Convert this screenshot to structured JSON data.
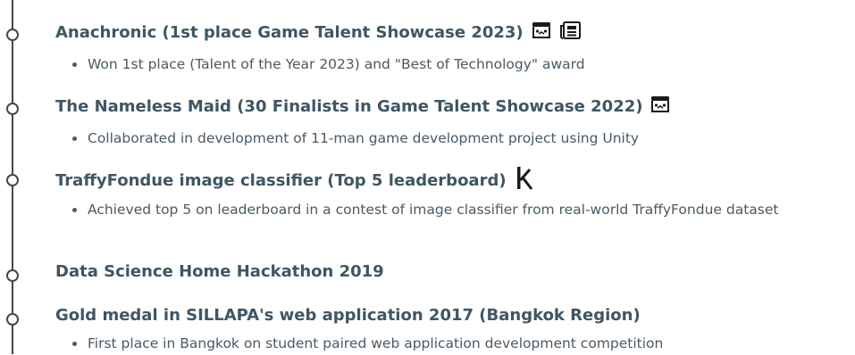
{
  "entries": [
    {
      "title": "Anachronic (1st place Game Talent Showcase 2023)",
      "icons": [
        "itchio-store-icon",
        "newspaper-icon"
      ],
      "bullets": [
        "Won 1st place (Talent of the Year 2023) and \"Best of Technology\" award"
      ]
    },
    {
      "title": "The Nameless Maid (30 Finalists in Game Talent Showcase 2022)",
      "icons": [
        "itchio-store-icon"
      ],
      "bullets": [
        "Collaborated in development of 11-man game development project using Unity"
      ]
    },
    {
      "title": "TraffyFondue image classifier (Top 5 leaderboard)",
      "icons": [
        "kaggle-icon"
      ],
      "bullets": [
        "Achieved top 5 on leaderboard in a contest of image classifier from real-world TraffyFondue dataset"
      ]
    },
    {
      "title": "Data Science Home Hackathon 2019",
      "icons": [],
      "bullets": []
    },
    {
      "title": "Gold medal in SILLAPA's web application 2017 (Bangkok Region)",
      "icons": [],
      "bullets": [
        "First place in Bangkok on student paired web application development competition"
      ]
    }
  ],
  "colors": {
    "title": "#3f5663",
    "text": "#4a5a65",
    "timeline": "#3d4a52"
  }
}
